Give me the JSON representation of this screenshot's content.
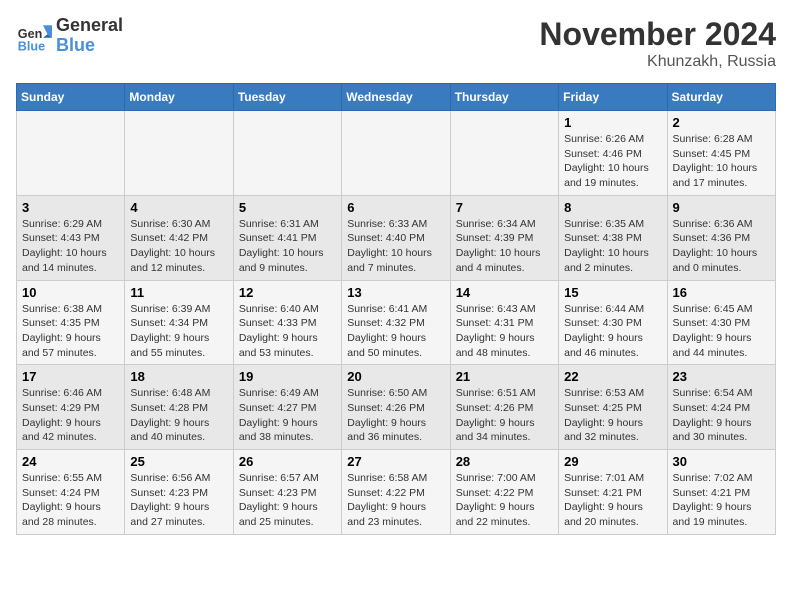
{
  "logo": {
    "line1": "General",
    "line2": "Blue"
  },
  "title": "November 2024",
  "location": "Khunzakh, Russia",
  "days_of_week": [
    "Sunday",
    "Monday",
    "Tuesday",
    "Wednesday",
    "Thursday",
    "Friday",
    "Saturday"
  ],
  "weeks": [
    [
      {
        "day": "",
        "info": ""
      },
      {
        "day": "",
        "info": ""
      },
      {
        "day": "",
        "info": ""
      },
      {
        "day": "",
        "info": ""
      },
      {
        "day": "",
        "info": ""
      },
      {
        "day": "1",
        "info": "Sunrise: 6:26 AM\nSunset: 4:46 PM\nDaylight: 10 hours and 19 minutes."
      },
      {
        "day": "2",
        "info": "Sunrise: 6:28 AM\nSunset: 4:45 PM\nDaylight: 10 hours and 17 minutes."
      }
    ],
    [
      {
        "day": "3",
        "info": "Sunrise: 6:29 AM\nSunset: 4:43 PM\nDaylight: 10 hours and 14 minutes."
      },
      {
        "day": "4",
        "info": "Sunrise: 6:30 AM\nSunset: 4:42 PM\nDaylight: 10 hours and 12 minutes."
      },
      {
        "day": "5",
        "info": "Sunrise: 6:31 AM\nSunset: 4:41 PM\nDaylight: 10 hours and 9 minutes."
      },
      {
        "day": "6",
        "info": "Sunrise: 6:33 AM\nSunset: 4:40 PM\nDaylight: 10 hours and 7 minutes."
      },
      {
        "day": "7",
        "info": "Sunrise: 6:34 AM\nSunset: 4:39 PM\nDaylight: 10 hours and 4 minutes."
      },
      {
        "day": "8",
        "info": "Sunrise: 6:35 AM\nSunset: 4:38 PM\nDaylight: 10 hours and 2 minutes."
      },
      {
        "day": "9",
        "info": "Sunrise: 6:36 AM\nSunset: 4:36 PM\nDaylight: 10 hours and 0 minutes."
      }
    ],
    [
      {
        "day": "10",
        "info": "Sunrise: 6:38 AM\nSunset: 4:35 PM\nDaylight: 9 hours and 57 minutes."
      },
      {
        "day": "11",
        "info": "Sunrise: 6:39 AM\nSunset: 4:34 PM\nDaylight: 9 hours and 55 minutes."
      },
      {
        "day": "12",
        "info": "Sunrise: 6:40 AM\nSunset: 4:33 PM\nDaylight: 9 hours and 53 minutes."
      },
      {
        "day": "13",
        "info": "Sunrise: 6:41 AM\nSunset: 4:32 PM\nDaylight: 9 hours and 50 minutes."
      },
      {
        "day": "14",
        "info": "Sunrise: 6:43 AM\nSunset: 4:31 PM\nDaylight: 9 hours and 48 minutes."
      },
      {
        "day": "15",
        "info": "Sunrise: 6:44 AM\nSunset: 4:30 PM\nDaylight: 9 hours and 46 minutes."
      },
      {
        "day": "16",
        "info": "Sunrise: 6:45 AM\nSunset: 4:30 PM\nDaylight: 9 hours and 44 minutes."
      }
    ],
    [
      {
        "day": "17",
        "info": "Sunrise: 6:46 AM\nSunset: 4:29 PM\nDaylight: 9 hours and 42 minutes."
      },
      {
        "day": "18",
        "info": "Sunrise: 6:48 AM\nSunset: 4:28 PM\nDaylight: 9 hours and 40 minutes."
      },
      {
        "day": "19",
        "info": "Sunrise: 6:49 AM\nSunset: 4:27 PM\nDaylight: 9 hours and 38 minutes."
      },
      {
        "day": "20",
        "info": "Sunrise: 6:50 AM\nSunset: 4:26 PM\nDaylight: 9 hours and 36 minutes."
      },
      {
        "day": "21",
        "info": "Sunrise: 6:51 AM\nSunset: 4:26 PM\nDaylight: 9 hours and 34 minutes."
      },
      {
        "day": "22",
        "info": "Sunrise: 6:53 AM\nSunset: 4:25 PM\nDaylight: 9 hours and 32 minutes."
      },
      {
        "day": "23",
        "info": "Sunrise: 6:54 AM\nSunset: 4:24 PM\nDaylight: 9 hours and 30 minutes."
      }
    ],
    [
      {
        "day": "24",
        "info": "Sunrise: 6:55 AM\nSunset: 4:24 PM\nDaylight: 9 hours and 28 minutes."
      },
      {
        "day": "25",
        "info": "Sunrise: 6:56 AM\nSunset: 4:23 PM\nDaylight: 9 hours and 27 minutes."
      },
      {
        "day": "26",
        "info": "Sunrise: 6:57 AM\nSunset: 4:23 PM\nDaylight: 9 hours and 25 minutes."
      },
      {
        "day": "27",
        "info": "Sunrise: 6:58 AM\nSunset: 4:22 PM\nDaylight: 9 hours and 23 minutes."
      },
      {
        "day": "28",
        "info": "Sunrise: 7:00 AM\nSunset: 4:22 PM\nDaylight: 9 hours and 22 minutes."
      },
      {
        "day": "29",
        "info": "Sunrise: 7:01 AM\nSunset: 4:21 PM\nDaylight: 9 hours and 20 minutes."
      },
      {
        "day": "30",
        "info": "Sunrise: 7:02 AM\nSunset: 4:21 PM\nDaylight: 9 hours and 19 minutes."
      }
    ]
  ]
}
